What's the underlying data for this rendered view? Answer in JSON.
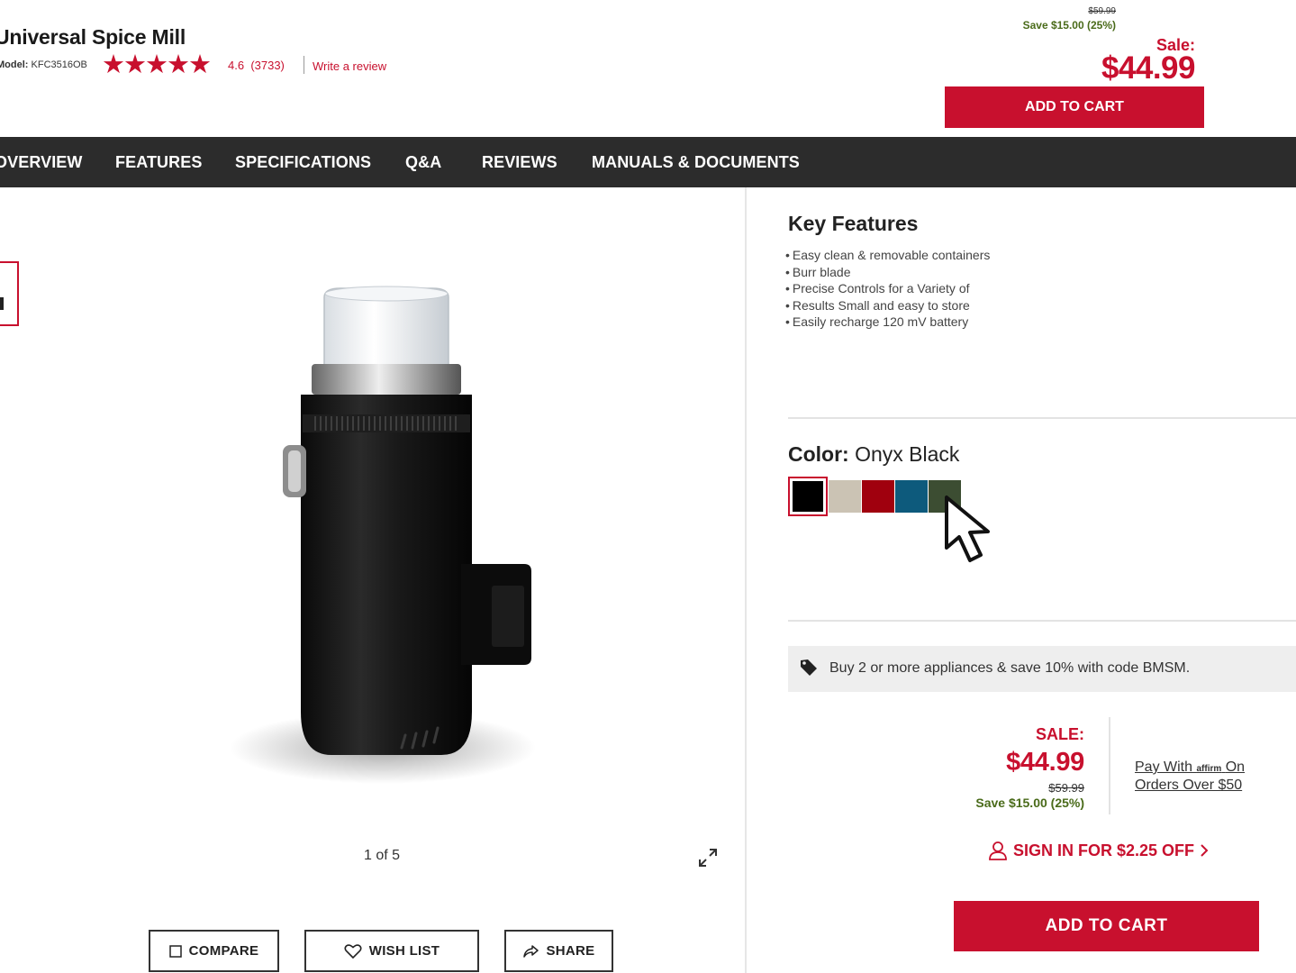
{
  "header": {
    "title": "Universal Spice Mill",
    "model_label": "Model:",
    "model_number": "KFC3516OB",
    "stars": "★★★★★",
    "rating": "4.6",
    "review_count": "(3733)",
    "write_review": "Write a review"
  },
  "top_price": {
    "was": "$59.99",
    "save": "Save $15.00 (25%)",
    "sale_label": "Sale:",
    "price": "$44.99",
    "add_to_cart": "ADD TO CART"
  },
  "nav": {
    "tabs": [
      "OVERVIEW",
      "FEATURES",
      "SPECIFICATIONS",
      "Q&A",
      "REVIEWS",
      "MANUALS & DOCUMENTS"
    ]
  },
  "gallery": {
    "counter": "1 of 5"
  },
  "actions": {
    "compare": "COMPARE",
    "wish_list": "WISH LIST",
    "share": "SHARE"
  },
  "key_features": {
    "title": "Key Features",
    "items": [
      "Easy clean & removable containers",
      "Burr blade",
      "Precise Controls for a Variety of",
      "Results Small and easy to store",
      "Easily recharge 120 mV battery"
    ]
  },
  "color": {
    "label": "Color:",
    "selected": "Onyx Black",
    "swatches": [
      {
        "name": "onyx-black",
        "hex": "#000000"
      },
      {
        "name": "beige",
        "hex": "#cbc3b4"
      },
      {
        "name": "red",
        "hex": "#a0000e"
      },
      {
        "name": "blue",
        "hex": "#0d5a7c"
      },
      {
        "name": "green",
        "hex": "#3c4d32"
      }
    ]
  },
  "promo": {
    "text": "Buy 2 or more appliances & save 10% with code BMSM."
  },
  "sale": {
    "label": "SALE:",
    "price": "$44.99",
    "was": "$59.99",
    "save": "Save $15.00 (25%)"
  },
  "affirm": {
    "line1_a": "Pay With",
    "logo": "affirm",
    "line1_b": "On",
    "line2": "Orders Over $50"
  },
  "signin": {
    "text": "SIGN IN FOR $2.25 OFF"
  },
  "main_cart": {
    "label": "ADD TO CART"
  },
  "colors": {
    "brand_red": "#c8102e",
    "save_green": "#4a6b1a",
    "nav_bg": "#2c2c2c"
  }
}
